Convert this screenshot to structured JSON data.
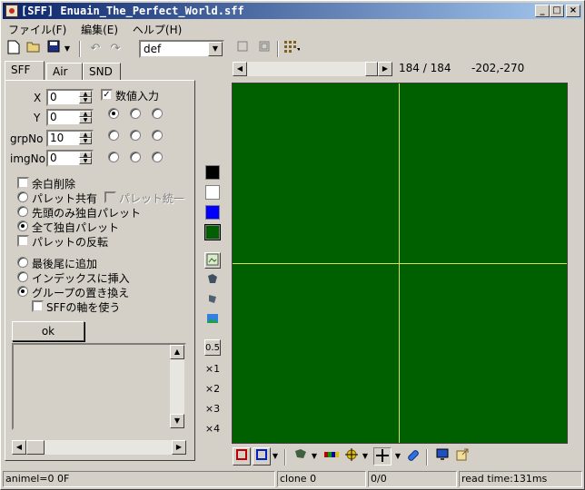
{
  "window": {
    "title": "[SFF] Enuain_The_Perfect_World.sff"
  },
  "title_buttons": {
    "minimize": "_",
    "maximize": "□",
    "close": "×"
  },
  "menu": {
    "file": "ファイル(F)",
    "edit": "編集(E)",
    "help": "ヘルプ(H)"
  },
  "toolbar": {
    "palette_combo": "def"
  },
  "tabs": [
    "SFF",
    "Air",
    "SND"
  ],
  "fields": {
    "x_label": "X",
    "x_value": "0",
    "y_label": "Y",
    "y_value": "0",
    "grp_label": "grpNo",
    "grp_value": "10",
    "img_label": "imgNo",
    "img_value": "0"
  },
  "numeric_input": {
    "label": "数値入力",
    "checked": true
  },
  "options": {
    "trim": "余白削除",
    "palette_shared": "パレット共有",
    "palette_unify": "パレット統一",
    "first_only": "先頭のみ独自パレット",
    "all_unique": "全て独自パレット",
    "palette_reverse": "パレットの反転",
    "append_last": "最後尾に追加",
    "insert_index": "インデックスに挿入",
    "replace_group": "グループの置き換え",
    "use_sff_axis": "SFFの軸を使う"
  },
  "ok_button": "ok",
  "frame": {
    "counter": "184 / 184",
    "coords": "-202,-270",
    "slider_fraction": 1.0
  },
  "zoom": {
    "half": "0.5",
    "x1": "×1",
    "x2": "×2",
    "x3": "×3",
    "x4": "×4"
  },
  "colors": {
    "canvas": "#006000",
    "axis": "#d8e060",
    "swatch_black": "#000000",
    "swatch_white": "#ffffff",
    "swatch_blue": "#0000ff",
    "swatch_green": "#006000"
  },
  "status": {
    "anim": "animel=0 0F",
    "clone": "clone 0",
    "count": "0/0",
    "readtime": "read time:131ms"
  }
}
